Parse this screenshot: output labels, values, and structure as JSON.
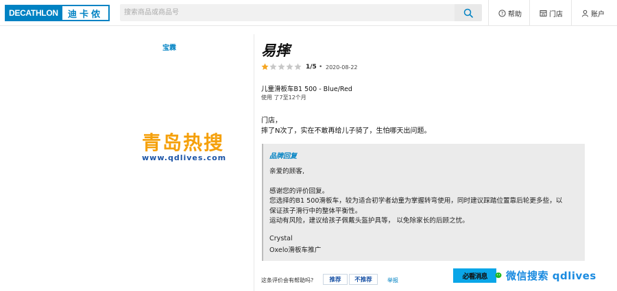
{
  "header": {
    "logo_en": "DECATHLON",
    "logo_zh": "迪卡侬",
    "search_placeholder": "搜索商品或商品号",
    "nav": [
      {
        "label": "帮助",
        "icon": "help-circle-icon"
      },
      {
        "label": "门店",
        "icon": "store-icon"
      },
      {
        "label": "账户",
        "icon": "user-icon"
      }
    ]
  },
  "sidebar": {
    "brand": "宝霖"
  },
  "watermark": {
    "title": "青岛热搜",
    "url": "www.qdlives.com",
    "qr_label": "必看消息",
    "wechat_text": "微信搜索 qdlives"
  },
  "review": {
    "title": "易摔",
    "rating_value": 1,
    "rating_max": 5,
    "rating_text": "1/5",
    "separator": "•",
    "date": "2020-08-22",
    "product": "儿童滑板车B1 500 - Blue/Red",
    "usage": "使用 了7至12个月",
    "body_line1": "门店，",
    "body_line2": "摔了N次了，实在不敢再给儿子骑了，生怕哪天出问题。",
    "colors": {
      "star_on": "#f5a623",
      "star_off": "#c8c8c8",
      "accent": "#0082c3"
    }
  },
  "reply": {
    "title": "品牌回复",
    "greeting": "亲爱的顾客,",
    "p1": "感谢您的评价回复。",
    "p2": "您选择的B1 500滑板车，较为适合初学者幼童为掌握转弯使用，同时建议踩踏位置靠后轮更多些，以",
    "p3": "保证孩子滑行中的整体平衡性。",
    "p4": "运动有风险，建议给孩子佩戴头盔护具等， 以免除家长的后顾之忧。",
    "signature": "Crystal",
    "team": "Oxelo滑板车推广"
  },
  "feedback": {
    "question": "这条评价会有帮助吗?",
    "yes": "推荐",
    "no": "不推荐",
    "report": "举报"
  }
}
